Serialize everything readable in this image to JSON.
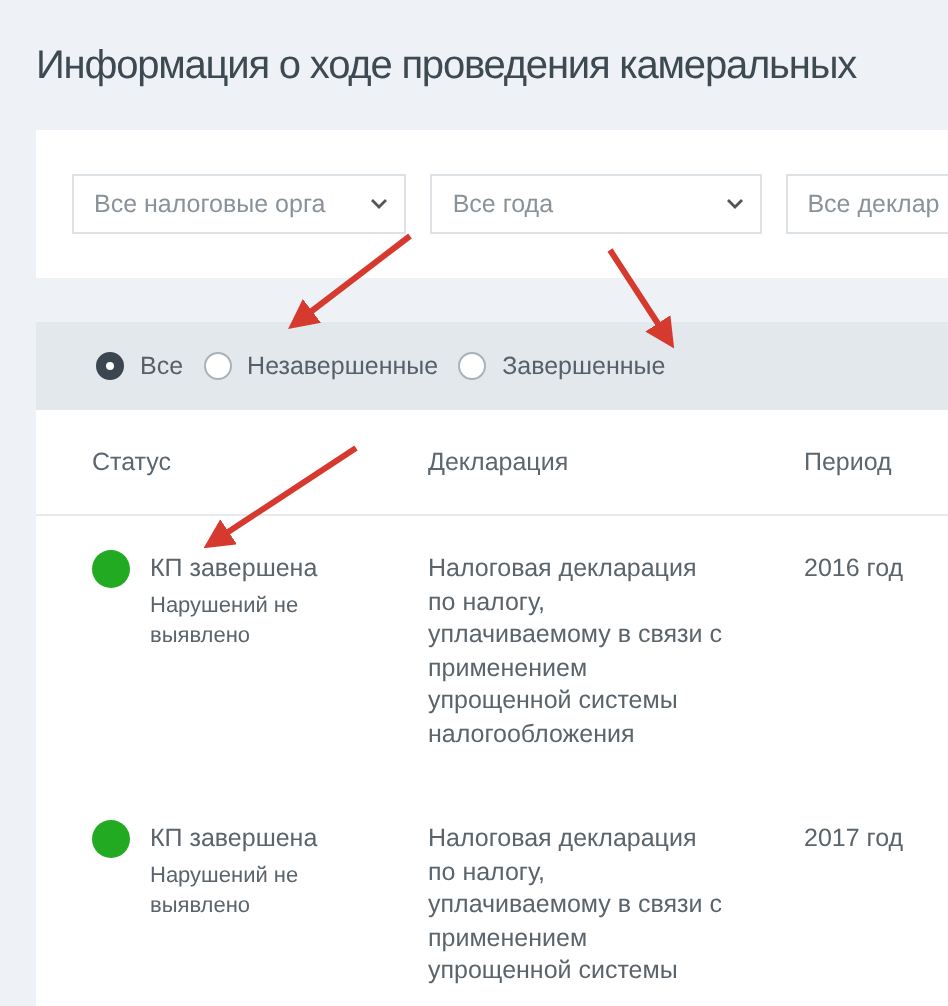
{
  "title": "Информация о ходе проведения камеральных",
  "filters": [
    {
      "value": "Все налоговые орга",
      "caret": true
    },
    {
      "value": "Все года",
      "caret": true
    },
    {
      "value": "Все деклар"
    }
  ],
  "status_filter": [
    {
      "label": "Все",
      "selected": true
    },
    {
      "label": "Незавершенные",
      "selected": false
    },
    {
      "label": "Завершенные",
      "selected": false
    }
  ],
  "table": {
    "columns": [
      "Статус",
      "Декларация",
      "Период"
    ],
    "rows": [
      {
        "status": "КП завершена",
        "color": "#22aa22",
        "note": "Нарушений не выявлено",
        "declaration": "Налоговая декларация по налогу, уплачиваемому в связи с применением упрощенной системы налогообложения",
        "period": "2016 год"
      },
      {
        "status": "КП завершена",
        "color": "#22aa22",
        "note": "Нарушений не выявлено",
        "declaration": "Налоговая декларация по налогу, уплачиваемому в связи с применением упрощенной системы",
        "period": "2017 год"
      }
    ]
  }
}
